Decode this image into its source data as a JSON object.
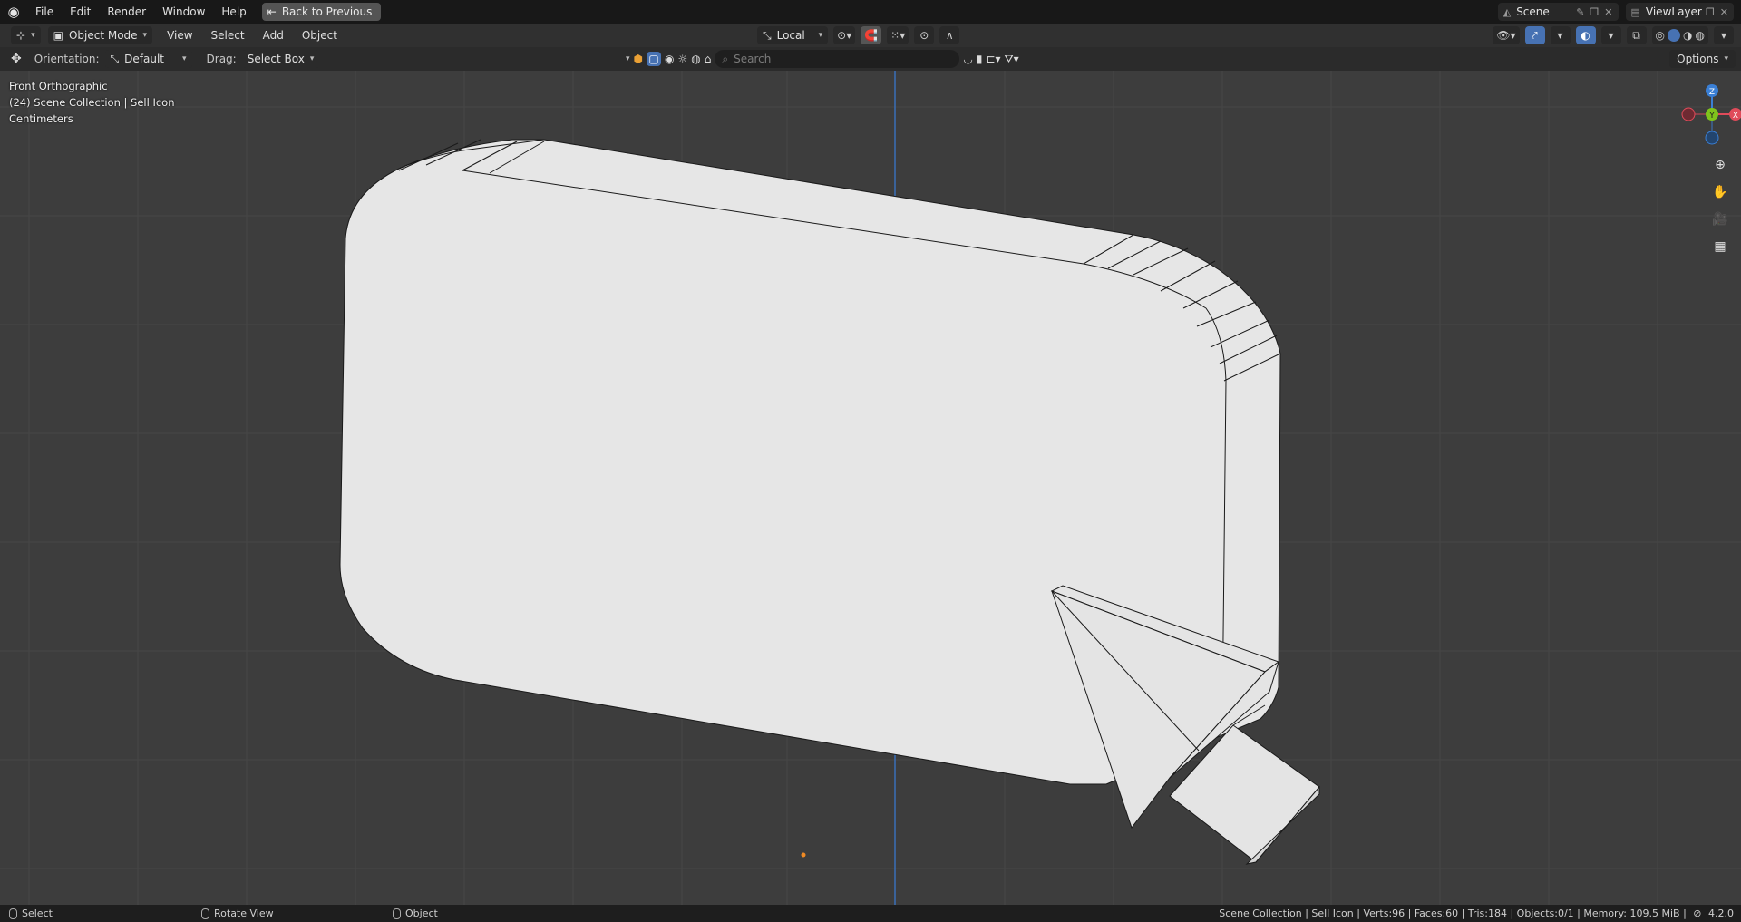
{
  "app": {
    "menu": [
      "File",
      "Edit",
      "Render",
      "Window",
      "Help"
    ],
    "back_button": "Back to Previous",
    "scene": "Scene",
    "view_layer": "ViewLayer"
  },
  "header": {
    "mode": "Object Mode",
    "menus": [
      "View",
      "Select",
      "Add",
      "Object"
    ],
    "transform_orientation": "Local"
  },
  "tool_settings": {
    "orientation_label": "Orientation:",
    "orientation_value": "Default",
    "drag_label": "Drag:",
    "drag_value": "Select Box",
    "search_placeholder": "Search",
    "options_label": "Options"
  },
  "viewport": {
    "view_name": "Front Orthographic",
    "collection_info": "(24) Scene Collection | Sell Icon",
    "units": "Centimeters",
    "gizmo_axes": [
      "Z",
      "Y",
      "X"
    ]
  },
  "statusbar": {
    "hint_select": "Select",
    "hint_rotate": "Rotate View",
    "hint_object": "Object",
    "stats": "Scene Collection | Sell Icon | Verts:96 | Faces:60 | Tris:184 | Objects:0/1 | Memory: 109.5 MiB |",
    "version": "4.2.0"
  },
  "colors": {
    "viewport_bg": "#3d3d3d",
    "accent_blue": "#4772b3",
    "axis_x": "#e04b5a",
    "axis_y": "#7fc41c",
    "axis_z": "#3a7fd5"
  }
}
